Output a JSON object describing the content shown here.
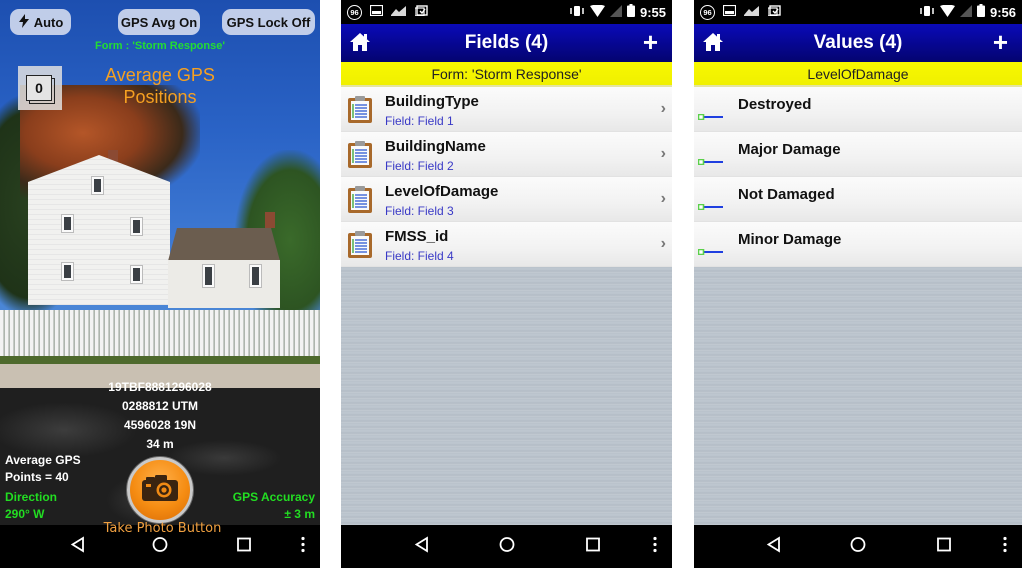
{
  "camera_screen": {
    "buttons": {
      "flash_label": "Auto",
      "gps_avg_label": "GPS Avg On",
      "gps_lock_label": "GPS Lock Off"
    },
    "form_label": "Form : 'Storm Response'",
    "photo_count": "0",
    "overlay_title_line1": "Average GPS",
    "overlay_title_line2": "Positions",
    "coordinates": {
      "mgrs": "19TBF8881296028",
      "easting": "0288812  UTM",
      "northing": "4596028  19N",
      "elevation": "34 m"
    },
    "avg_points": {
      "line1": "Average GPS",
      "line2": "Points = 40"
    },
    "direction": {
      "label": "Direction",
      "value": "290° W"
    },
    "accuracy": {
      "label": "GPS Accuracy",
      "value": "± 3 m"
    },
    "shutter_label": "Take Photo Button"
  },
  "fields_screen": {
    "status": {
      "notif_badge": "96",
      "time": "9:55"
    },
    "title": "Fields (4)",
    "add_symbol": "+",
    "subheader": "Form: 'Storm Response'",
    "items": [
      {
        "name": "BuildingType",
        "sub": "Field: Field 1"
      },
      {
        "name": "BuildingName",
        "sub": "Field: Field 2"
      },
      {
        "name": "LevelOfDamage",
        "sub": "Field: Field 3"
      },
      {
        "name": "FMSS_id",
        "sub": "Field: Field 4"
      }
    ],
    "chevron": "›"
  },
  "values_screen": {
    "status": {
      "notif_badge": "96",
      "time": "9:56"
    },
    "title": "Values (4)",
    "add_symbol": "+",
    "subheader": "LevelOfDamage",
    "items": [
      {
        "name": "Destroyed"
      },
      {
        "name": "Major Damage"
      },
      {
        "name": "Not Damaged"
      },
      {
        "name": "Minor Damage"
      }
    ]
  },
  "colors": {
    "title_bar": "#06068c",
    "subheader": "#f0f000",
    "gps_green": "#22dd33",
    "overlay_orange": "#f5a021",
    "field_sub_blue": "#3939c6"
  }
}
